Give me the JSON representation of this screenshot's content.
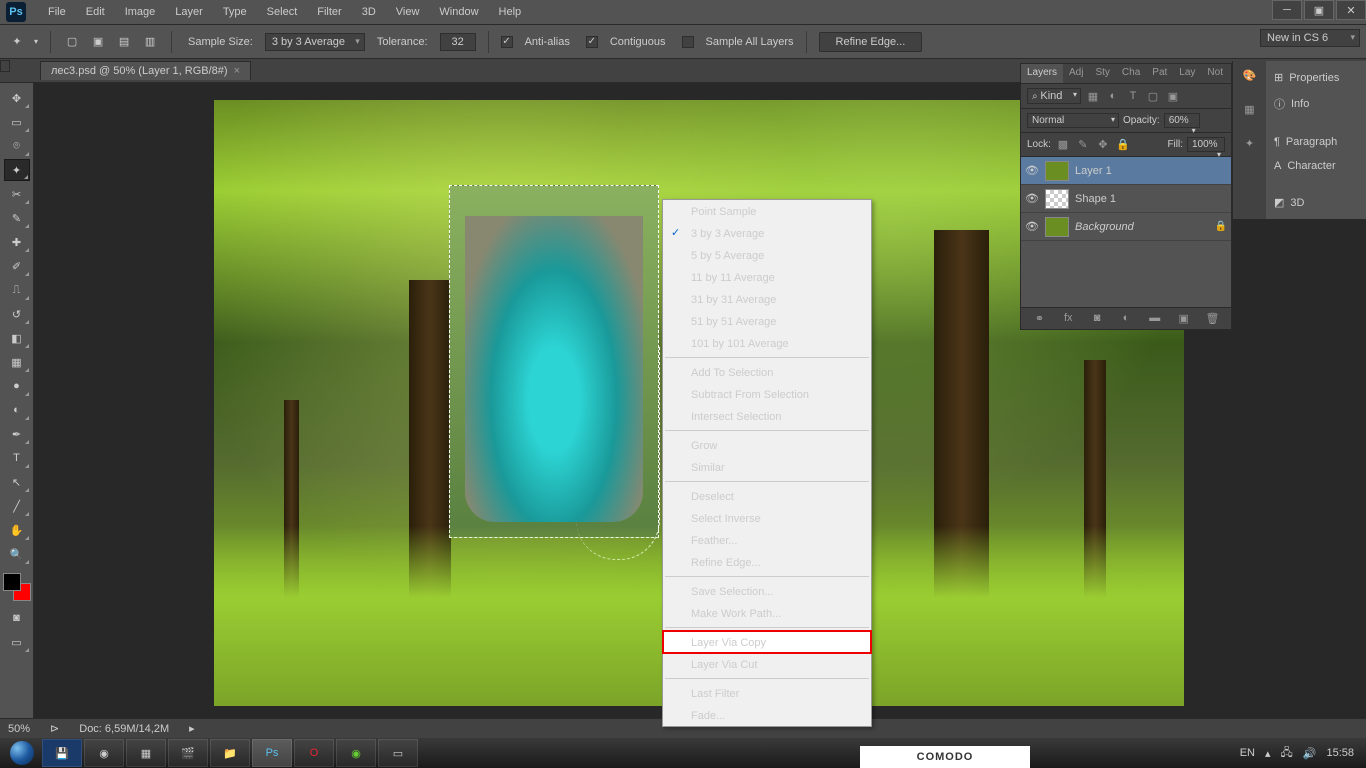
{
  "menubar": {
    "items": [
      "File",
      "Edit",
      "Image",
      "Layer",
      "Type",
      "Select",
      "Filter",
      "3D",
      "View",
      "Window",
      "Help"
    ]
  },
  "optionsbar": {
    "sample_size_label": "Sample Size:",
    "sample_size_value": "3 by 3 Average",
    "tolerance_label": "Tolerance:",
    "tolerance_value": "32",
    "antialias": "Anti-alias",
    "contiguous": "Contiguous",
    "sample_all": "Sample All Layers",
    "refine": "Refine Edge...",
    "new_cs6": "New in CS 6"
  },
  "document": {
    "tab_title": "лес3.psd @ 50% (Layer 1, RGB/8#)"
  },
  "context_menu": {
    "items": [
      {
        "label": "Point Sample"
      },
      {
        "label": "3 by 3 Average",
        "checked": true
      },
      {
        "label": "5 by 5 Average"
      },
      {
        "label": "11 by 11 Average"
      },
      {
        "label": "31 by 31 Average"
      },
      {
        "label": "51 by 51 Average"
      },
      {
        "label": "101 by 101 Average"
      },
      {
        "sep": true
      },
      {
        "label": "Add To Selection"
      },
      {
        "label": "Subtract From Selection"
      },
      {
        "label": "Intersect Selection"
      },
      {
        "sep": true
      },
      {
        "label": "Grow"
      },
      {
        "label": "Similar"
      },
      {
        "sep": true
      },
      {
        "label": "Deselect"
      },
      {
        "label": "Select Inverse"
      },
      {
        "label": "Feather..."
      },
      {
        "label": "Refine Edge..."
      },
      {
        "sep": true
      },
      {
        "label": "Save Selection..."
      },
      {
        "label": "Make Work Path..."
      },
      {
        "sep": true
      },
      {
        "label": "Layer Via Copy",
        "highlight": true
      },
      {
        "label": "Layer Via Cut"
      },
      {
        "sep": true
      },
      {
        "label": "Last Filter",
        "disabled": true
      },
      {
        "label": "Fade...",
        "disabled": true
      }
    ]
  },
  "layers_panel": {
    "tabs": [
      "Layers",
      "Adj",
      "Sty",
      "Cha",
      "Pat",
      "Lay",
      "Not"
    ],
    "filter": "Kind",
    "blend": "Normal",
    "opacity_label": "Opacity:",
    "opacity": "60%",
    "lock_label": "Lock:",
    "fill_label": "Fill:",
    "fill": "100%",
    "layers": [
      {
        "name": "Layer 1",
        "selected": true
      },
      {
        "name": "Shape 1"
      },
      {
        "name": "Background",
        "locked": true,
        "italic": true
      }
    ]
  },
  "side_panel": {
    "items": [
      "Properties",
      "Info",
      "Paragraph",
      "Character",
      "3D"
    ]
  },
  "statusbar": {
    "zoom": "50%",
    "doc": "Doc: 6,59M/14,2M"
  },
  "taskbar": {
    "lang": "EN",
    "time": "15:58"
  },
  "comodo": "COMODO"
}
